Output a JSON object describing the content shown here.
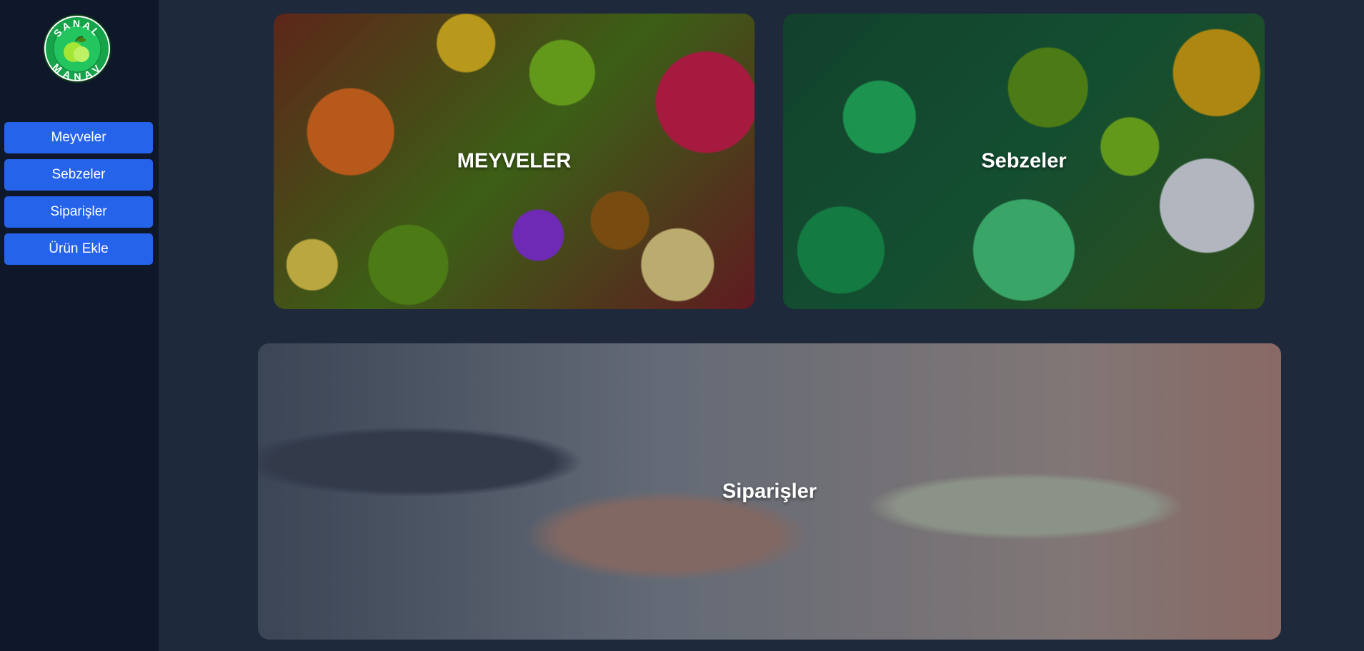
{
  "logo": {
    "top_text": "SANAL",
    "bottom_text": "MANAV"
  },
  "sidebar": {
    "items": [
      {
        "label": "Meyveler"
      },
      {
        "label": "Sebzeler"
      },
      {
        "label": "Siparişler"
      },
      {
        "label": "Ürün Ekle"
      }
    ]
  },
  "cards": {
    "fruits": {
      "label": "MEYVELER"
    },
    "vegetables": {
      "label": "Sebzeler"
    },
    "orders": {
      "label": "Siparişler"
    }
  },
  "colors": {
    "background": "#1e293b",
    "sidebar": "#0f172a",
    "accent": "#2563eb",
    "logo_green": "#16a34a"
  }
}
